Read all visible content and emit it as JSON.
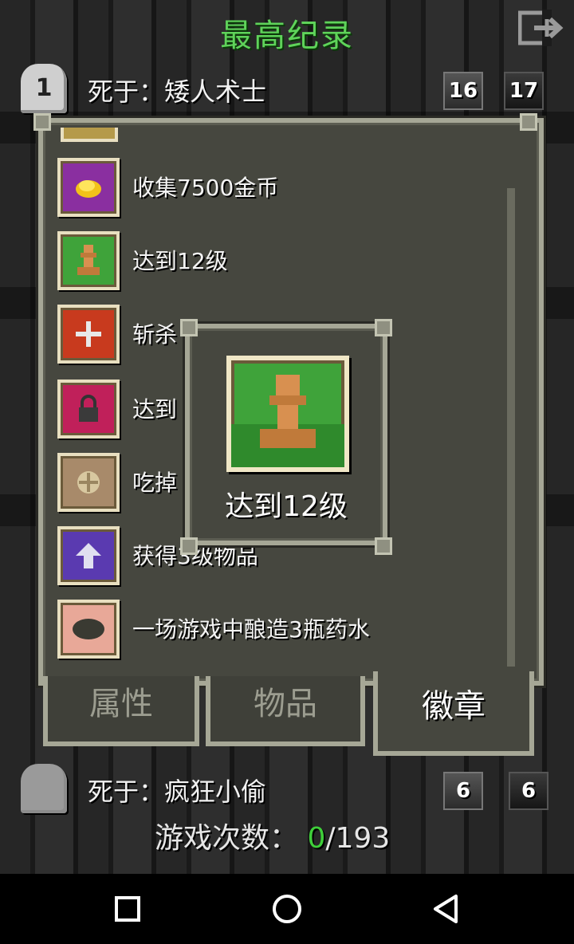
{
  "title": "最高纪录",
  "icons": {
    "exit": "exit-icon",
    "tomb": "tombstone-icon"
  },
  "records": [
    {
      "rank": "1",
      "text": "死于：矮人术士",
      "depth": "16",
      "level": "17"
    },
    {
      "rank": "",
      "text": "死于：疯狂小偷",
      "depth": "6",
      "level": "6"
    }
  ],
  "badges": [
    {
      "label": "收集7500金币",
      "color": "#8a2fa0",
      "icon": "gold-coins-icon"
    },
    {
      "label": "达到12级",
      "color": "#3fa33a",
      "icon": "pawn-icon"
    },
    {
      "label": "斩杀",
      "color": "#c83a1e",
      "icon": "cross-swords-icon"
    },
    {
      "label": "达到",
      "color": "#c0205a",
      "icon": "lock-icon"
    },
    {
      "label": "吃掉",
      "color": "#a88a6a",
      "icon": "food-icon"
    },
    {
      "label": "获得3级物品",
      "color": "#5a3ab0",
      "icon": "upgrade-arrow-icon"
    },
    {
      "label": "一场游戏中酿造3瓶药水",
      "color": "#e8a898",
      "icon": "potion-icon"
    }
  ],
  "tabs": [
    {
      "label": "属性"
    },
    {
      "label": "物品"
    },
    {
      "label": "徽章"
    }
  ],
  "popup": {
    "label": "达到12级",
    "icon": "pawn-icon",
    "color": "#3fa33a"
  },
  "games": {
    "label": "游戏次数：",
    "current": "0",
    "total": "/193"
  },
  "nav": {
    "back": "back-icon",
    "home": "home-icon",
    "recents": "recents-icon"
  }
}
